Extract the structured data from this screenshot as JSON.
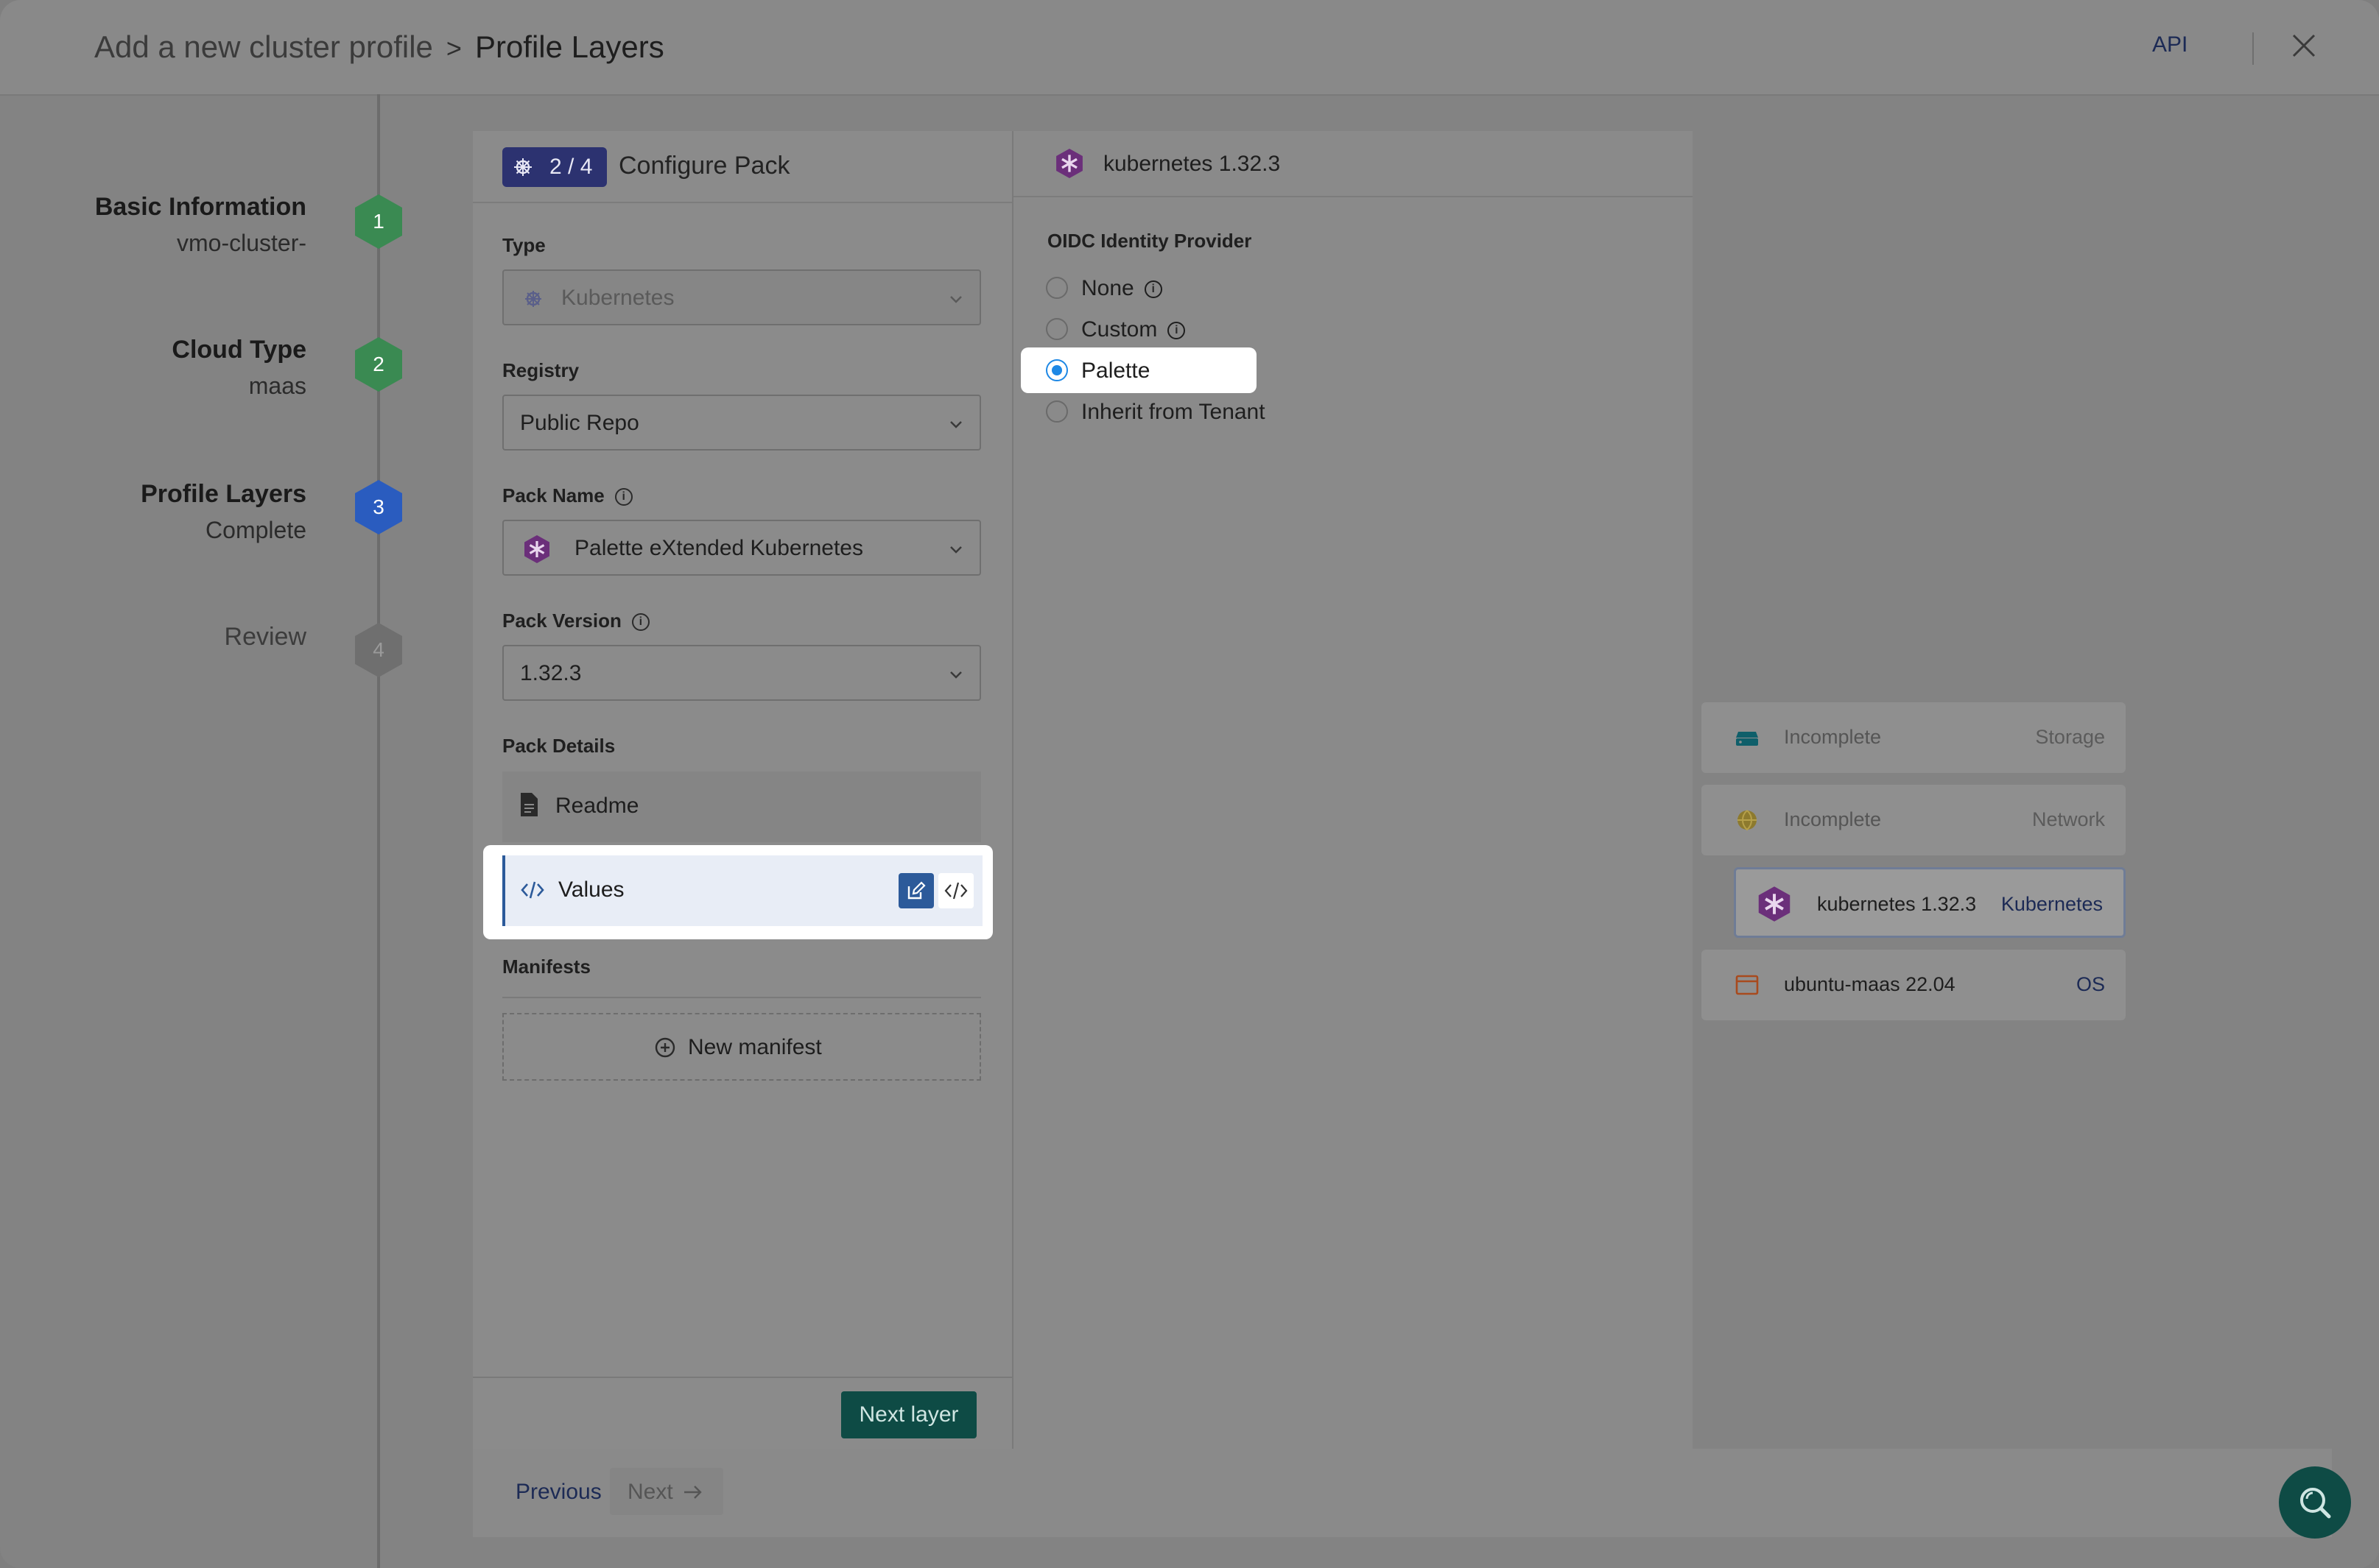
{
  "header": {
    "breadcrumb_root": "Add a new cluster profile",
    "breadcrumb_sep": ">",
    "breadcrumb_current": "Profile Layers",
    "api_label": "API"
  },
  "stepper": {
    "steps": [
      {
        "title": "Basic Information",
        "subtitle": "vmo-cluster-",
        "number": "1",
        "state": "done"
      },
      {
        "title": "Cloud Type",
        "subtitle": "maas",
        "number": "2",
        "state": "done"
      },
      {
        "title": "Profile Layers",
        "subtitle": "Complete",
        "number": "3",
        "state": "current"
      },
      {
        "title": "Review",
        "subtitle": "",
        "number": "4",
        "state": "pending"
      }
    ]
  },
  "configure": {
    "counter": "2 / 4",
    "title": "Configure Pack",
    "type_label": "Type",
    "type_value": "Kubernetes",
    "registry_label": "Registry",
    "registry_value": "Public Repo",
    "pack_name_label": "Pack Name",
    "pack_name_value": "Palette eXtended Kubernetes",
    "pack_version_label": "Pack Version",
    "pack_version_value": "1.32.3",
    "pack_details_label": "Pack Details",
    "readme_label": "Readme",
    "values_label": "Values",
    "manifests_label": "Manifests",
    "new_manifest_label": "New manifest",
    "next_layer_label": "Next layer"
  },
  "pack_values": {
    "title": "kubernetes 1.32.3",
    "oidc_label": "OIDC Identity Provider",
    "options": [
      "None",
      "Custom",
      "Palette",
      "Inherit from Tenant"
    ],
    "selected": "Palette"
  },
  "layers": [
    {
      "name": "Incomplete",
      "type": "Storage"
    },
    {
      "name": "Incomplete",
      "type": "Network"
    },
    {
      "name": "kubernetes 1.32.3",
      "type": "Kubernetes"
    },
    {
      "name": "ubuntu-maas 22.04",
      "type": "OS"
    }
  ],
  "footer": {
    "previous_label": "Previous",
    "next_label": "Next"
  },
  "colors": {
    "accent_green": "#0e4b45",
    "step_done": "#3a8a52",
    "step_current": "#2a5cbf",
    "radio_selected": "#1e88e5"
  }
}
